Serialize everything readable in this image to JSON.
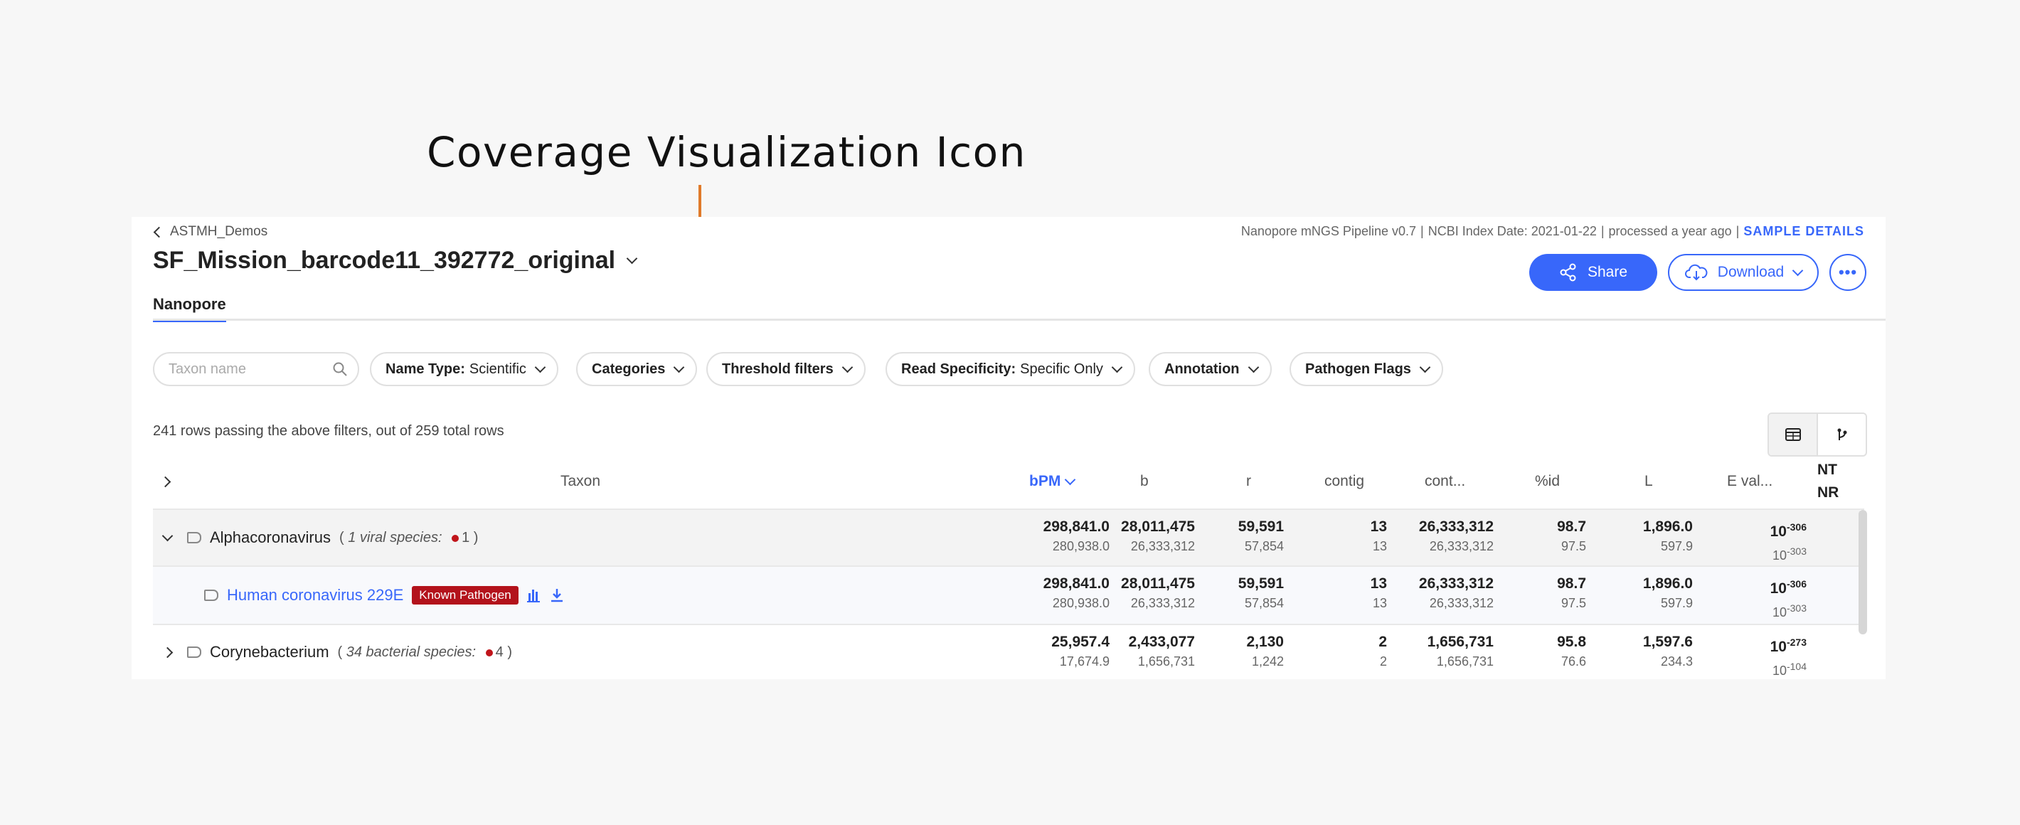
{
  "annotation": {
    "label": "Coverage Visualization Icon",
    "color": "#e07a2a"
  },
  "header": {
    "breadcrumb": "ASTMH_Demos",
    "sample_name": "SF_Mission_barcode11_392772_original",
    "pipeline": "Nanopore mNGS Pipeline v0.7",
    "index_date": "NCBI Index Date: 2021-01-22",
    "processed": "processed a year ago",
    "sample_details": "SAMPLE DETAILS",
    "share": "Share",
    "download": "Download",
    "more": "•••"
  },
  "tabs": [
    "Nanopore"
  ],
  "filters": {
    "search_placeholder": "Taxon name",
    "name_type_label": "Name Type:",
    "name_type_value": "Scientific",
    "categories": "Categories",
    "threshold": "Threshold filters",
    "read_spec_label": "Read Specificity:",
    "read_spec_value": "Specific Only",
    "annotation": "Annotation",
    "pathogen_flags": "Pathogen Flags"
  },
  "row_count": "241 rows passing the above filters, out of 259 total rows",
  "columns": {
    "taxon": "Taxon",
    "bpm": "bPM",
    "b": "b",
    "r": "r",
    "contig": "contig",
    "cont": "cont...",
    "pid": "%id",
    "L": "L",
    "eval": "E val...",
    "nt": "NT",
    "nr": "NR"
  },
  "rows": [
    {
      "name": "Alphacoronavirus",
      "species_note": "1 viral species:",
      "flag_count": "1",
      "bpm": [
        "298,841.0",
        "280,938.0"
      ],
      "b": [
        "28,011,475",
        "26,333,312"
      ],
      "r": [
        "59,591",
        "57,854"
      ],
      "contig": [
        "13",
        "13"
      ],
      "cont": [
        "26,333,312",
        "26,333,312"
      ],
      "pid": [
        "98.7",
        "97.5"
      ],
      "L": [
        "1,896.0",
        "597.9"
      ],
      "eval_exp": [
        "-306",
        "-303"
      ]
    },
    {
      "name": "Human coronavirus 229E",
      "badge": "Known Pathogen",
      "bpm": [
        "298,841.0",
        "280,938.0"
      ],
      "b": [
        "28,011,475",
        "26,333,312"
      ],
      "r": [
        "59,591",
        "57,854"
      ],
      "contig": [
        "13",
        "13"
      ],
      "cont": [
        "26,333,312",
        "26,333,312"
      ],
      "pid": [
        "98.7",
        "97.5"
      ],
      "L": [
        "1,896.0",
        "597.9"
      ],
      "eval_exp": [
        "-306",
        "-303"
      ]
    },
    {
      "name": "Corynebacterium",
      "species_note": "34 bacterial species:",
      "flag_count": "4",
      "bpm": [
        "25,957.4",
        "17,674.9"
      ],
      "b": [
        "2,433,077",
        "1,656,731"
      ],
      "r": [
        "2,130",
        "1,242"
      ],
      "contig": [
        "2",
        "2"
      ],
      "cont": [
        "1,656,731",
        "1,656,731"
      ],
      "pid": [
        "95.8",
        "76.6"
      ],
      "L": [
        "1,597.6",
        "234.3"
      ],
      "eval_exp": [
        "-273",
        "-104"
      ]
    }
  ],
  "eval_base": "10",
  "paren_open": "(",
  "paren_close": ")"
}
